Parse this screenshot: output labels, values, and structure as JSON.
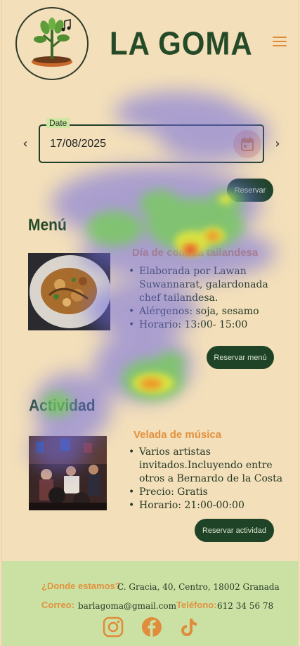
{
  "brand": {
    "name": "LA GOMA",
    "logo_icon": "plant-music-logo-icon"
  },
  "header": {
    "menu_icon": "hamburger-menu-icon"
  },
  "date_picker": {
    "label": "Date",
    "value": "17/08/2025",
    "prev_icon": "chevron-left-icon",
    "next_icon": "chevron-right-icon",
    "calendar_icon": "calendar-icon"
  },
  "reserve": {
    "label": "Reservar"
  },
  "menu": {
    "heading": "Menú",
    "title": "Día de comida tailandesa",
    "bullets": [
      "Elaborada por Lawan Suwannarat, galardonada chef tailandesa.",
      "Alérgenos: soja, sesamo",
      "Horario: 13:00- 15:00"
    ],
    "button": "Reservar menú"
  },
  "activity": {
    "heading": "Actividad",
    "title": "Velada de música",
    "bullets": [
      "Varios artistas invitados.Incluyendo entre otros a Bernardo de la Costa",
      "Precio: Gratis",
      "Horario: 21:00-00:00"
    ],
    "button": "Reservar actividad"
  },
  "footer": {
    "where_label": "¿Donde estamos?",
    "address": "C. Gracia, 40, Centro, 18002 Granada",
    "email_label": "Correo:",
    "email": "barlagoma@gmail.com",
    "phone_label": "Teléfono:",
    "phone": "612 34 56 78",
    "social": [
      "instagram-icon",
      "facebook-icon",
      "tiktok-icon"
    ]
  },
  "colors": {
    "background": "#f3dfb9",
    "brand_green": "#244a27",
    "accent_orange": "#e2913e",
    "footer_green": "#cbe1a4",
    "button_dark": "#1f4326"
  }
}
